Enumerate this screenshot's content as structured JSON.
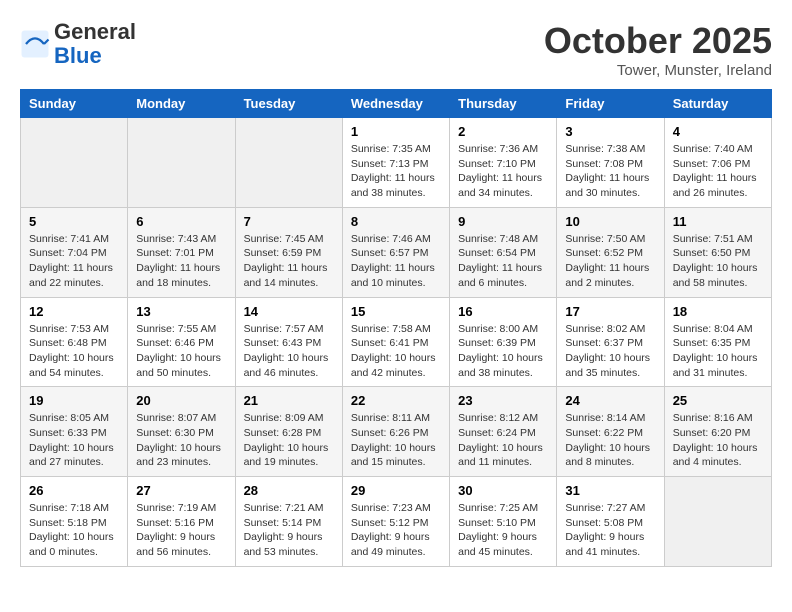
{
  "header": {
    "logo_line1": "General",
    "logo_line2": "Blue",
    "title": "October 2025",
    "subtitle": "Tower, Munster, Ireland"
  },
  "days_of_week": [
    "Sunday",
    "Monday",
    "Tuesday",
    "Wednesday",
    "Thursday",
    "Friday",
    "Saturday"
  ],
  "weeks": [
    [
      {
        "day": "",
        "info": ""
      },
      {
        "day": "",
        "info": ""
      },
      {
        "day": "",
        "info": ""
      },
      {
        "day": "1",
        "info": "Sunrise: 7:35 AM\nSunset: 7:13 PM\nDaylight: 11 hours and 38 minutes."
      },
      {
        "day": "2",
        "info": "Sunrise: 7:36 AM\nSunset: 7:10 PM\nDaylight: 11 hours and 34 minutes."
      },
      {
        "day": "3",
        "info": "Sunrise: 7:38 AM\nSunset: 7:08 PM\nDaylight: 11 hours and 30 minutes."
      },
      {
        "day": "4",
        "info": "Sunrise: 7:40 AM\nSunset: 7:06 PM\nDaylight: 11 hours and 26 minutes."
      }
    ],
    [
      {
        "day": "5",
        "info": "Sunrise: 7:41 AM\nSunset: 7:04 PM\nDaylight: 11 hours and 22 minutes."
      },
      {
        "day": "6",
        "info": "Sunrise: 7:43 AM\nSunset: 7:01 PM\nDaylight: 11 hours and 18 minutes."
      },
      {
        "day": "7",
        "info": "Sunrise: 7:45 AM\nSunset: 6:59 PM\nDaylight: 11 hours and 14 minutes."
      },
      {
        "day": "8",
        "info": "Sunrise: 7:46 AM\nSunset: 6:57 PM\nDaylight: 11 hours and 10 minutes."
      },
      {
        "day": "9",
        "info": "Sunrise: 7:48 AM\nSunset: 6:54 PM\nDaylight: 11 hours and 6 minutes."
      },
      {
        "day": "10",
        "info": "Sunrise: 7:50 AM\nSunset: 6:52 PM\nDaylight: 11 hours and 2 minutes."
      },
      {
        "day": "11",
        "info": "Sunrise: 7:51 AM\nSunset: 6:50 PM\nDaylight: 10 hours and 58 minutes."
      }
    ],
    [
      {
        "day": "12",
        "info": "Sunrise: 7:53 AM\nSunset: 6:48 PM\nDaylight: 10 hours and 54 minutes."
      },
      {
        "day": "13",
        "info": "Sunrise: 7:55 AM\nSunset: 6:46 PM\nDaylight: 10 hours and 50 minutes."
      },
      {
        "day": "14",
        "info": "Sunrise: 7:57 AM\nSunset: 6:43 PM\nDaylight: 10 hours and 46 minutes."
      },
      {
        "day": "15",
        "info": "Sunrise: 7:58 AM\nSunset: 6:41 PM\nDaylight: 10 hours and 42 minutes."
      },
      {
        "day": "16",
        "info": "Sunrise: 8:00 AM\nSunset: 6:39 PM\nDaylight: 10 hours and 38 minutes."
      },
      {
        "day": "17",
        "info": "Sunrise: 8:02 AM\nSunset: 6:37 PM\nDaylight: 10 hours and 35 minutes."
      },
      {
        "day": "18",
        "info": "Sunrise: 8:04 AM\nSunset: 6:35 PM\nDaylight: 10 hours and 31 minutes."
      }
    ],
    [
      {
        "day": "19",
        "info": "Sunrise: 8:05 AM\nSunset: 6:33 PM\nDaylight: 10 hours and 27 minutes."
      },
      {
        "day": "20",
        "info": "Sunrise: 8:07 AM\nSunset: 6:30 PM\nDaylight: 10 hours and 23 minutes."
      },
      {
        "day": "21",
        "info": "Sunrise: 8:09 AM\nSunset: 6:28 PM\nDaylight: 10 hours and 19 minutes."
      },
      {
        "day": "22",
        "info": "Sunrise: 8:11 AM\nSunset: 6:26 PM\nDaylight: 10 hours and 15 minutes."
      },
      {
        "day": "23",
        "info": "Sunrise: 8:12 AM\nSunset: 6:24 PM\nDaylight: 10 hours and 11 minutes."
      },
      {
        "day": "24",
        "info": "Sunrise: 8:14 AM\nSunset: 6:22 PM\nDaylight: 10 hours and 8 minutes."
      },
      {
        "day": "25",
        "info": "Sunrise: 8:16 AM\nSunset: 6:20 PM\nDaylight: 10 hours and 4 minutes."
      }
    ],
    [
      {
        "day": "26",
        "info": "Sunrise: 7:18 AM\nSunset: 5:18 PM\nDaylight: 10 hours and 0 minutes."
      },
      {
        "day": "27",
        "info": "Sunrise: 7:19 AM\nSunset: 5:16 PM\nDaylight: 9 hours and 56 minutes."
      },
      {
        "day": "28",
        "info": "Sunrise: 7:21 AM\nSunset: 5:14 PM\nDaylight: 9 hours and 53 minutes."
      },
      {
        "day": "29",
        "info": "Sunrise: 7:23 AM\nSunset: 5:12 PM\nDaylight: 9 hours and 49 minutes."
      },
      {
        "day": "30",
        "info": "Sunrise: 7:25 AM\nSunset: 5:10 PM\nDaylight: 9 hours and 45 minutes."
      },
      {
        "day": "31",
        "info": "Sunrise: 7:27 AM\nSunset: 5:08 PM\nDaylight: 9 hours and 41 minutes."
      },
      {
        "day": "",
        "info": ""
      }
    ]
  ]
}
